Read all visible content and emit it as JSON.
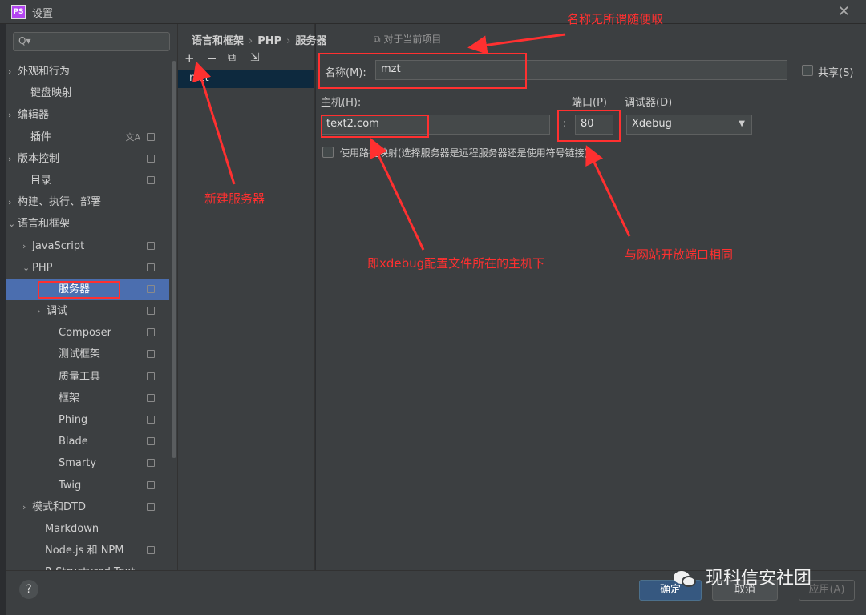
{
  "window": {
    "title": "设置",
    "app_icon": "PS"
  },
  "sidebar": {
    "search_placeholder": "Q▾",
    "items": [
      {
        "label": "外观和行为",
        "arrow": "›",
        "indent": 14,
        "proj": false,
        "selected": false
      },
      {
        "label": "键盘映射",
        "arrow": "",
        "indent": 30,
        "proj": false,
        "selected": false
      },
      {
        "label": "编辑器",
        "arrow": "›",
        "indent": 14,
        "proj": false,
        "selected": false
      },
      {
        "label": "插件",
        "arrow": "",
        "indent": 30,
        "proj": true,
        "trans": true,
        "selected": false
      },
      {
        "label": "版本控制",
        "arrow": "›",
        "indent": 14,
        "proj": true,
        "selected": false
      },
      {
        "label": "目录",
        "arrow": "",
        "indent": 30,
        "proj": true,
        "selected": false
      },
      {
        "label": "构建、执行、部署",
        "arrow": "›",
        "indent": 14,
        "proj": false,
        "selected": false
      },
      {
        "label": "语言和框架",
        "arrow": "⌄",
        "indent": 14,
        "proj": false,
        "selected": false
      },
      {
        "label": "JavaScript",
        "arrow": "›",
        "indent": 32,
        "proj": true,
        "selected": false
      },
      {
        "label": "PHP",
        "arrow": "⌄",
        "indent": 32,
        "proj": true,
        "selected": false
      },
      {
        "label": "服务器",
        "arrow": "",
        "indent": 65,
        "proj": true,
        "selected": true
      },
      {
        "label": "调试",
        "arrow": "›",
        "indent": 50,
        "proj": true,
        "selected": false
      },
      {
        "label": "Composer",
        "arrow": "",
        "indent": 65,
        "proj": true,
        "selected": false
      },
      {
        "label": "测试框架",
        "arrow": "",
        "indent": 65,
        "proj": true,
        "selected": false
      },
      {
        "label": "质量工具",
        "arrow": "",
        "indent": 65,
        "proj": true,
        "selected": false
      },
      {
        "label": "框架",
        "arrow": "",
        "indent": 65,
        "proj": true,
        "selected": false
      },
      {
        "label": "Phing",
        "arrow": "",
        "indent": 65,
        "proj": true,
        "selected": false
      },
      {
        "label": "Blade",
        "arrow": "",
        "indent": 65,
        "proj": true,
        "selected": false
      },
      {
        "label": "Smarty",
        "arrow": "",
        "indent": 65,
        "proj": true,
        "selected": false
      },
      {
        "label": "Twig",
        "arrow": "",
        "indent": 65,
        "proj": true,
        "selected": false
      },
      {
        "label": "模式和DTD",
        "arrow": "›",
        "indent": 32,
        "proj": true,
        "selected": false
      },
      {
        "label": "Markdown",
        "arrow": "",
        "indent": 48,
        "proj": false,
        "selected": false
      },
      {
        "label": "Node.js 和 NPM",
        "arrow": "",
        "indent": 48,
        "proj": true,
        "selected": false
      },
      {
        "label": "R Structured Text",
        "arrow": "",
        "indent": 48,
        "proj": false,
        "selected": false
      }
    ]
  },
  "breadcrumb": {
    "items": [
      "语言和框架",
      "PHP",
      "服务器"
    ],
    "sep": "›",
    "project_note": "⧉ 对于当前项目"
  },
  "toolbar": {
    "add": "+",
    "remove": "−",
    "copy": "⧉",
    "import": "⇲"
  },
  "servers": [
    "mzt"
  ],
  "form": {
    "name_label": "名称(M):",
    "name_value": "mzt",
    "share_label": "共享(S)",
    "host_label": "主机(H):",
    "host_value": "text2.com",
    "port_label": "端口(P)",
    "port_colon": ":",
    "port_value": "80",
    "debugger_label": "调试器(D)",
    "debugger_value": "Xdebug",
    "path_mapping_label": "使用路径映射(选择服务器是远程服务器还是使用符号链接)"
  },
  "annotations": {
    "name_note": "名称无所谓随便取",
    "new_server_note": "新建服务器",
    "host_note": "即xdebug配置文件所在的主机下",
    "port_note": "与网站开放端口相同"
  },
  "buttons": {
    "help": "?",
    "ok": "确定",
    "cancel": "取消",
    "apply": "应用(A)"
  },
  "watermark": "现科信安社团",
  "colors": {
    "accent": "#4b6eaf",
    "annotation": "#ff3030",
    "background": "#3c3f41"
  }
}
